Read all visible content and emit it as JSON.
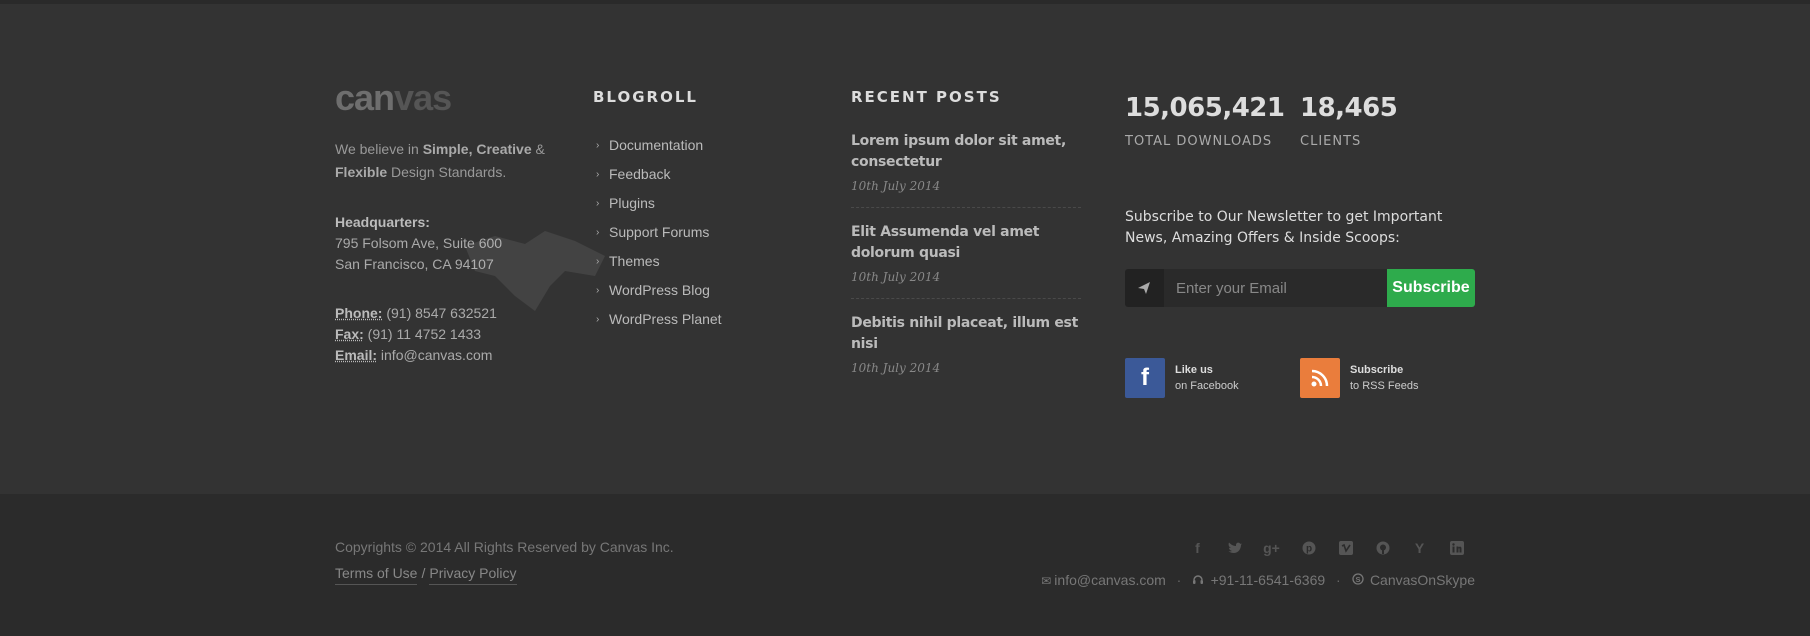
{
  "brand": {
    "logo_text_bold": "can",
    "logo_text_light": "vas"
  },
  "about": {
    "tagline_prefix": "We believe in ",
    "tagline_strong1": "Simple, Creative",
    "tagline_mid": " & ",
    "tagline_strong2": "Flexible",
    "tagline_suffix": " Design Standards.",
    "hq_label": "Headquarters:",
    "address_line1": "795 Folsom Ave, Suite 600",
    "address_line2": "San Francisco, CA 94107",
    "phone_label": "Phone:",
    "phone_value": " (91) 8547 632521",
    "fax_label": "Fax:",
    "fax_value": " (91) 11 4752 1433",
    "email_label": "Email:",
    "email_value": " info@canvas.com"
  },
  "blogroll": {
    "title": "BLOGROLL",
    "items": [
      "Documentation",
      "Feedback",
      "Plugins",
      "Support Forums",
      "Themes",
      "WordPress Blog",
      "WordPress Planet"
    ]
  },
  "recent_posts": {
    "title": "RECENT POSTS",
    "posts": [
      {
        "title": "Lorem ipsum dolor sit amet, consectetur",
        "date": "10th July 2014"
      },
      {
        "title": "Elit Assumenda vel amet dolorum quasi",
        "date": "10th July 2014"
      },
      {
        "title": "Debitis nihil placeat, illum est nisi",
        "date": "10th July 2014"
      }
    ]
  },
  "counters": [
    {
      "value": "15,065,421",
      "label": "TOTAL DOWNLOADS"
    },
    {
      "value": "18,465",
      "label": "CLIENTS"
    }
  ],
  "newsletter": {
    "text": "Subscribe to Our Newsletter to get Important News, Amazing Offers & Inside Scoops:",
    "placeholder": "Enter your Email",
    "button_label": "Subscribe"
  },
  "social_widgets": [
    {
      "icon": "facebook-icon",
      "line1": "Like us",
      "line2": "on Facebook",
      "color": "#3b5998"
    },
    {
      "icon": "rss-icon",
      "line1": "Subscribe",
      "line2": "to RSS Feeds",
      "color": "#ea7d3c"
    }
  ],
  "copyright": {
    "text": "Copyrights © 2014 All Rights Reserved by Canvas Inc.",
    "terms": "Terms of Use",
    "separator": "/",
    "privacy": "Privacy Policy"
  },
  "footer_social_icons": [
    "facebook-icon",
    "twitter-icon",
    "google-plus-icon",
    "pinterest-icon",
    "vimeo-icon",
    "github-icon",
    "yahoo-icon",
    "linkedin-icon"
  ],
  "footer_contact": {
    "email": "info@canvas.com",
    "phone": "+91-11-6541-6369",
    "skype": "CanvasOnSkype"
  },
  "colors": {
    "subscribe_green": "#2eab4c",
    "facebook_blue": "#3b5998",
    "rss_orange": "#ea7d3c"
  }
}
